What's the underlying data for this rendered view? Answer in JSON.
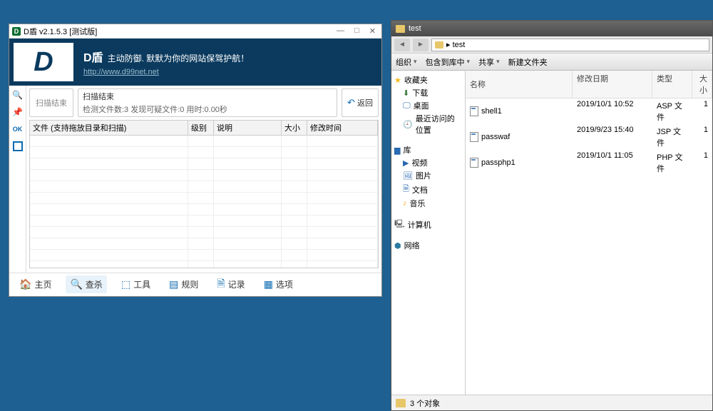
{
  "d": {
    "title": "D盾 v2.1.5.3 [测试版]",
    "banner": {
      "name": "D盾",
      "slogan": "主动防御. 默默为你的网站保驾护航！",
      "url": "http://www.d99net.net"
    },
    "side": {
      "ok": "OK"
    },
    "scan": {
      "end_label": "扫描结束",
      "result_title": "扫描结束",
      "result_detail": "检测文件数:3 发现可疑文件:0 用时:0.00秒",
      "back_label": "返回"
    },
    "cols": {
      "file": "文件 (支持拖放目录和扫描)",
      "level": "级别",
      "desc": "说明",
      "size": "大小",
      "mtime": "修改时间"
    },
    "tabs": {
      "home": "主页",
      "scan": "查杀",
      "tools": "工具",
      "rules": "规则",
      "log": "记录",
      "options": "选项"
    }
  },
  "e": {
    "title": "test",
    "path": "▸ test",
    "toolbar": {
      "org": "组织",
      "include": "包含到库中",
      "share": "共享",
      "newfolder": "新建文件夹"
    },
    "tree": {
      "fav": "收藏夹",
      "downloads": "下载",
      "desktop": "桌面",
      "recent": "最近访问的位置",
      "libs": "库",
      "videos": "视频",
      "pictures": "图片",
      "docs": "文档",
      "music": "音乐",
      "computer": "计算机",
      "network": "网络"
    },
    "cols": {
      "name": "名称",
      "date": "修改日期",
      "type": "类型",
      "size": "大小"
    },
    "files": [
      {
        "name": "shell1",
        "date": "2019/10/1 10:52",
        "type": "ASP 文件",
        "size": "1"
      },
      {
        "name": "passwaf",
        "date": "2019/9/23 15:40",
        "type": "JSP 文件",
        "size": "1"
      },
      {
        "name": "passphp1",
        "date": "2019/10/1 11:05",
        "type": "PHP 文件",
        "size": "1"
      }
    ],
    "status": "3 个对象"
  }
}
